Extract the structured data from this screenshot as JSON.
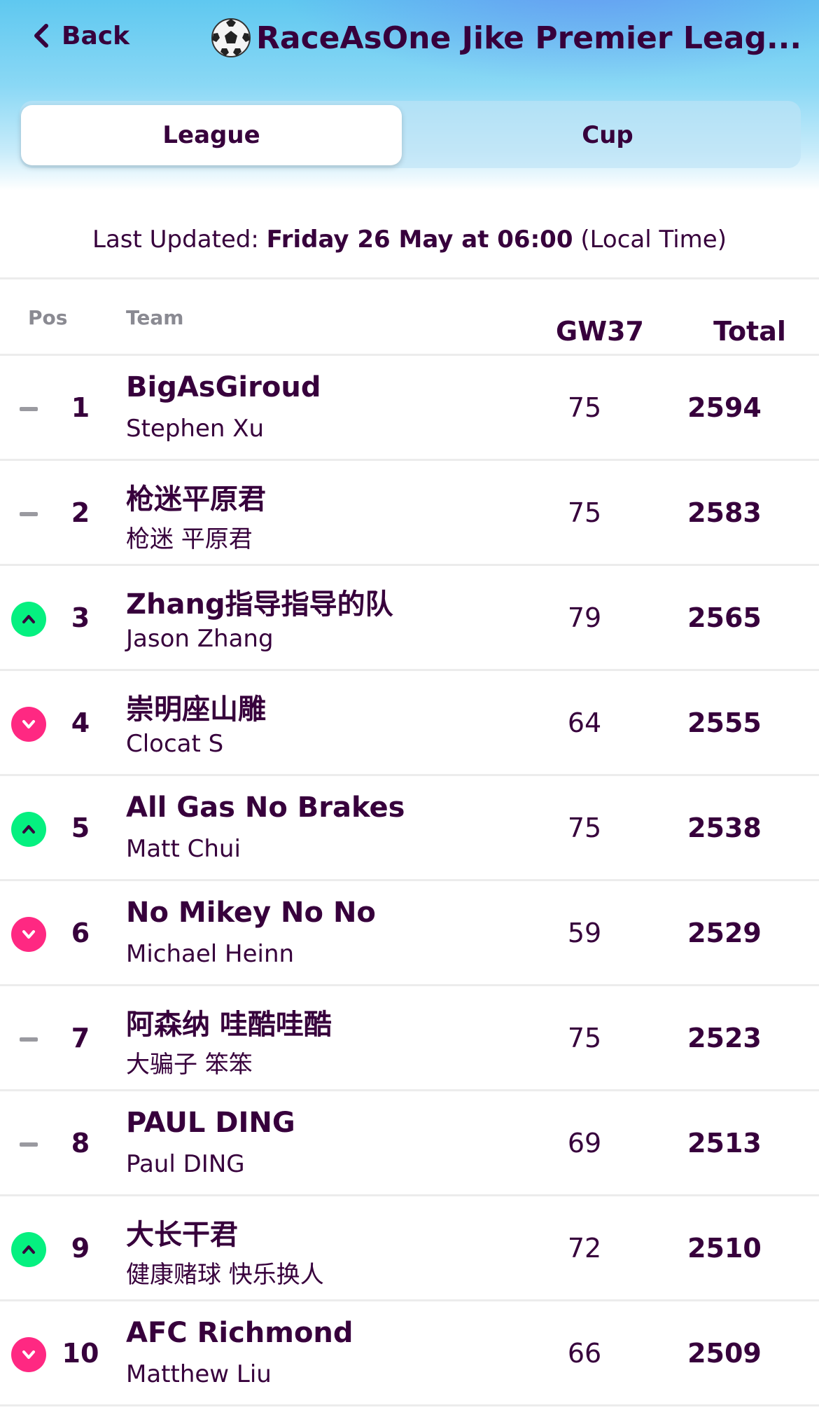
{
  "header": {
    "back_label": "Back",
    "title": "RaceAsOne Jike Premier Leag...",
    "title_icon": "soccer-ball-icon"
  },
  "tabs": [
    {
      "label": "League",
      "active": true
    },
    {
      "label": "Cup",
      "active": false
    }
  ],
  "updated": {
    "prefix": "Last Updated:",
    "datetime": "Friday 26 May at 06:00",
    "suffix": "(Local Time)"
  },
  "table": {
    "columns": {
      "pos": "Pos",
      "team": "Team",
      "gw": "GW37",
      "total": "Total"
    },
    "rows": [
      {
        "rank": "1",
        "movement": "same",
        "team": "BigAsGiroud",
        "manager": "Stephen Xu",
        "gw": "75",
        "total": "2594"
      },
      {
        "rank": "2",
        "movement": "same",
        "team": "枪迷平原君",
        "manager": "枪迷 平原君",
        "gw": "75",
        "total": "2583"
      },
      {
        "rank": "3",
        "movement": "up",
        "team": "Zhang指导指导的队",
        "manager": "Jason Zhang",
        "gw": "79",
        "total": "2565"
      },
      {
        "rank": "4",
        "movement": "down",
        "team": "崇明座山雕",
        "manager": "Clocat S",
        "gw": "64",
        "total": "2555"
      },
      {
        "rank": "5",
        "movement": "up",
        "team": "All Gas No Brakes",
        "manager": "Matt Chui",
        "gw": "75",
        "total": "2538"
      },
      {
        "rank": "6",
        "movement": "down",
        "team": "No Mikey No No",
        "manager": "Michael Heinn",
        "gw": "59",
        "total": "2529"
      },
      {
        "rank": "7",
        "movement": "same",
        "team": "阿森纳 哇酷哇酷",
        "manager": "大骗子 笨笨",
        "gw": "75",
        "total": "2523"
      },
      {
        "rank": "8",
        "movement": "same",
        "team": "PAUL DING",
        "manager": "Paul DING",
        "gw": "69",
        "total": "2513"
      },
      {
        "rank": "9",
        "movement": "up",
        "team": "大长干君",
        "manager": "健康赌球 快乐换人",
        "gw": "72",
        "total": "2510"
      },
      {
        "rank": "10",
        "movement": "down",
        "team": "AFC Richmond",
        "manager": "Matthew Liu",
        "gw": "66",
        "total": "2509"
      }
    ]
  },
  "colors": {
    "primary": "#37003c",
    "up": "#05f080",
    "down": "#ff2882",
    "same": "#9a9aa0"
  }
}
